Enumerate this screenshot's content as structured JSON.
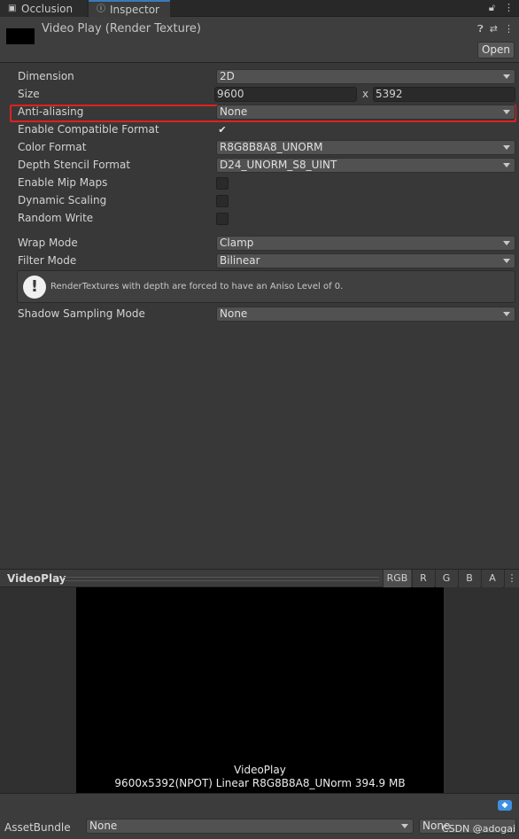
{
  "tabs": [
    {
      "label": "Occlusion",
      "icon": "occlusion-icon"
    },
    {
      "label": "Inspector",
      "icon": "info-icon"
    }
  ],
  "header": {
    "title": "Video Play (Render Texture)",
    "open_label": "Open"
  },
  "properties": {
    "dimension": {
      "label": "Dimension",
      "value": "2D"
    },
    "size": {
      "label": "Size",
      "width": "9600",
      "separator": "x",
      "height": "5392"
    },
    "anti_aliasing": {
      "label": "Anti-aliasing",
      "value": "None"
    },
    "enable_compatible_format": {
      "label": "Enable Compatible Format",
      "checked_mark": "✔"
    },
    "color_format": {
      "label": "Color Format",
      "value": "R8G8B8A8_UNORM"
    },
    "depth_stencil_format": {
      "label": "Depth Stencil Format",
      "value": "D24_UNORM_S8_UINT"
    },
    "enable_mip_maps": {
      "label": "Enable Mip Maps"
    },
    "dynamic_scaling": {
      "label": "Dynamic Scaling"
    },
    "random_write": {
      "label": "Random Write"
    },
    "wrap_mode": {
      "label": "Wrap Mode",
      "value": "Clamp"
    },
    "filter_mode": {
      "label": "Filter Mode",
      "value": "Bilinear"
    },
    "help_message": "RenderTextures with depth are forced to have an Aniso Level of 0.",
    "shadow_sampling_mode": {
      "label": "Shadow Sampling Mode",
      "value": "None"
    }
  },
  "preview": {
    "title": "VideoPlay",
    "channels": [
      "RGB",
      "R",
      "G",
      "B",
      "A"
    ],
    "active_channel": "RGB",
    "caption_name": "VideoPlay",
    "caption_info": "9600x5392(NPOT) Linear  R8G8B8A8_UNorm  394.9 MB"
  },
  "asset_bundle": {
    "label": "AssetBundle",
    "bundle_value": "None",
    "variant_value": "None"
  },
  "watermark": "CSDN @adogai",
  "colors": {
    "highlight_border": "#e02020",
    "active_tab_accent": "#3a79bb"
  }
}
